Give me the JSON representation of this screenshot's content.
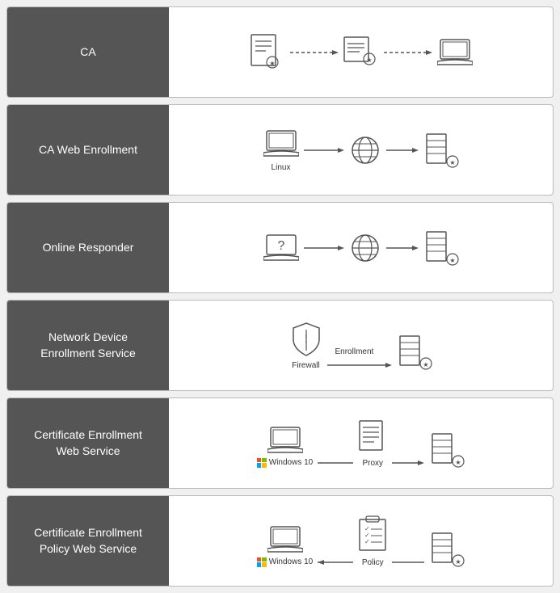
{
  "rows": [
    {
      "id": "ca",
      "label": "CA",
      "label2": "",
      "diagram_type": "ca"
    },
    {
      "id": "ca-web",
      "label": "CA Web Enrollment",
      "label2": "",
      "diagram_type": "ca-web"
    },
    {
      "id": "online-responder",
      "label": "Online Responder",
      "label2": "",
      "diagram_type": "online-responder"
    },
    {
      "id": "ndes",
      "label": "Network Device\nEnrollment Service",
      "label2": "",
      "diagram_type": "ndes"
    },
    {
      "id": "cews",
      "label": "Certificate Enrollment\nWeb Service",
      "label2": "",
      "diagram_type": "cews"
    },
    {
      "id": "cepws",
      "label": "Certificate Enrollment\nPolicy Web Service",
      "label2": "",
      "diagram_type": "cepws"
    }
  ],
  "labels": {
    "ca": "CA",
    "ca_web": "CA Web Enrollment",
    "online_responder": "Online Responder",
    "ndes": "Network Device\nEnrollment Service",
    "cews": "Certificate Enrollment\nWeb Service",
    "cepws": "Certificate Enrollment\nPolicy Web Service",
    "linux": "Linux",
    "firewall": "Firewall",
    "enrollment": "Enrollment",
    "windows10": "Windows 10",
    "proxy": "Proxy",
    "policy": "Policy"
  }
}
